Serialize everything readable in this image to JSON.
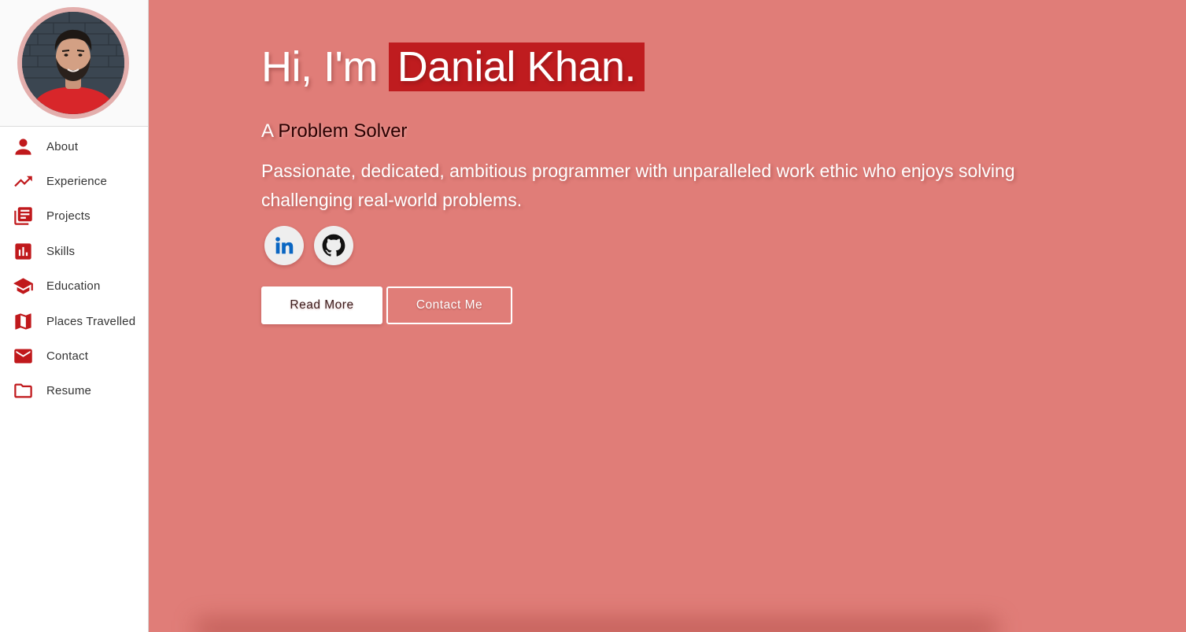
{
  "sidebar": {
    "avatar_alt": "Profile photo",
    "items": [
      {
        "label": "About",
        "icon": "person-icon"
      },
      {
        "label": "Experience",
        "icon": "trending-up-icon"
      },
      {
        "label": "Projects",
        "icon": "library-books-icon"
      },
      {
        "label": "Skills",
        "icon": "bar-chart-icon"
      },
      {
        "label": "Education",
        "icon": "graduation-cap-icon"
      },
      {
        "label": "Places Travelled",
        "icon": "map-icon"
      },
      {
        "label": "Contact",
        "icon": "mail-icon"
      },
      {
        "label": "Resume",
        "icon": "folder-icon"
      }
    ]
  },
  "hero": {
    "greeting": "Hi, I'm",
    "name": "Danial Khan.",
    "tagline_prefix": "A",
    "tagline_accent": "Problem Solver",
    "description": "Passionate, dedicated, ambitious programmer with unparalleled work ethic who enjoys solving challenging real-world problems.",
    "social": [
      {
        "name": "LinkedIn",
        "icon": "linkedin-icon"
      },
      {
        "name": "GitHub",
        "icon": "github-icon"
      }
    ],
    "primary_button": "Read More",
    "secondary_button": "Contact Me"
  },
  "colors": {
    "accent": "#c0191c",
    "background": "#e07d78",
    "sidebar": "#ffffff",
    "name_highlight": "#bf1c1f"
  }
}
